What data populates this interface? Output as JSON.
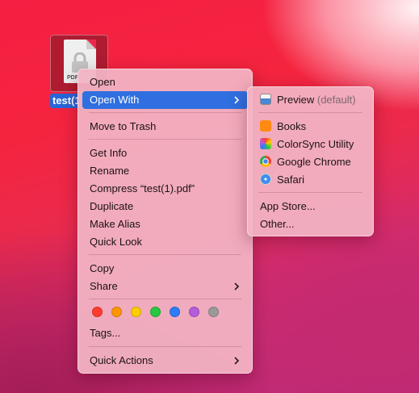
{
  "desktop": {
    "file": {
      "label": "test(1",
      "icon_text": "PDF",
      "icon": "pdf-document-locked-icon"
    }
  },
  "context_menu": {
    "open": "Open",
    "open_with": "Open With",
    "move_to_trash": "Move to Trash",
    "get_info": "Get Info",
    "rename": "Rename",
    "compress": "Compress “test(1).pdf”",
    "duplicate": "Duplicate",
    "make_alias": "Make Alias",
    "quick_look": "Quick Look",
    "copy": "Copy",
    "share": "Share",
    "tags": "Tags...",
    "quick_actions": "Quick Actions",
    "tag_colors": [
      {
        "name": "red",
        "color": "#ff3b30"
      },
      {
        "name": "orange",
        "color": "#ff9500"
      },
      {
        "name": "yellow",
        "color": "#ffcc00"
      },
      {
        "name": "green",
        "color": "#28c840"
      },
      {
        "name": "blue",
        "color": "#2f7cf6"
      },
      {
        "name": "purple",
        "color": "#b55cdb"
      },
      {
        "name": "gray",
        "color": "#9a9a9a"
      }
    ]
  },
  "open_with_submenu": {
    "apps": [
      {
        "name": "Preview",
        "suffix": " (default)",
        "icon": "preview-app-icon"
      },
      {
        "name": "Books",
        "suffix": "",
        "icon": "books-app-icon"
      },
      {
        "name": "ColorSync Utility",
        "suffix": "",
        "icon": "colorsync-utility-app-icon"
      },
      {
        "name": "Google Chrome",
        "suffix": "",
        "icon": "google-chrome-app-icon"
      },
      {
        "name": "Safari",
        "suffix": "",
        "icon": "safari-app-icon"
      }
    ],
    "app_store": "App Store...",
    "other": "Other..."
  },
  "colors": {
    "highlight": "#2f6fe0",
    "selection": "#2766d8"
  }
}
